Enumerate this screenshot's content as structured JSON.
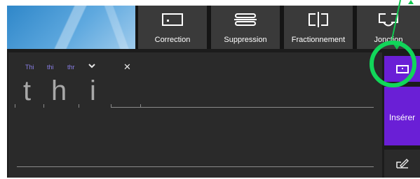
{
  "toolbar": {
    "buttons": [
      {
        "label": "Correction",
        "icon": "correction-icon"
      },
      {
        "label": "Suppression",
        "icon": "strikethrough-icon"
      },
      {
        "label": "Fractionnement",
        "icon": "split-icon"
      },
      {
        "label": "Jonction",
        "icon": "join-icon"
      }
    ]
  },
  "suggestions": [
    "Thi",
    "thi",
    "thr"
  ],
  "handwriting": [
    "t",
    "h",
    "i"
  ],
  "side": {
    "insert_label": "Insérer"
  },
  "colors": {
    "accent": "#6a1fd6",
    "highlight": "#11d65a",
    "suggestion_text": "#8a7fe8"
  }
}
